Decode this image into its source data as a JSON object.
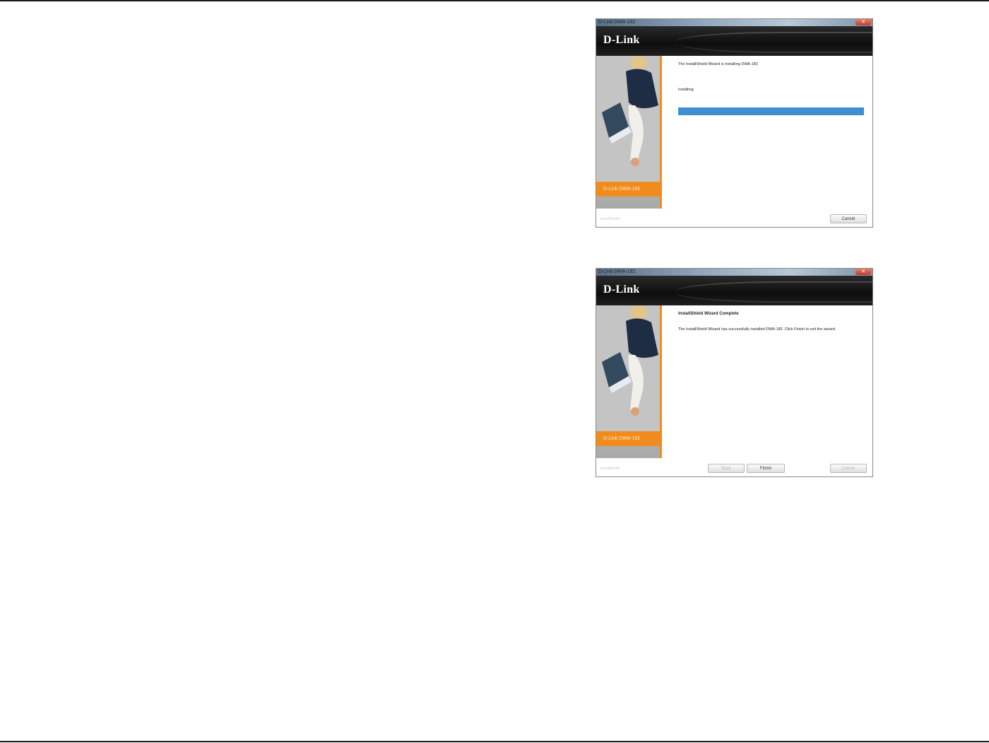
{
  "dialogs": [
    {
      "title": "D-Link DWA-182",
      "logo": "D-Link",
      "product_label": "D-Link DWA-182",
      "message": "The InstallShield Wizard is installing DWA-182",
      "status": "Installing",
      "progress_percent": 100,
      "footer_brand": "InstallShield",
      "cancel_label": "Cancel"
    },
    {
      "title": "D-Link DWA-182",
      "logo": "D-Link",
      "product_label": "D-Link DWA-182",
      "heading": "InstallShield Wizard Complete",
      "message": "The InstallShield Wizard has successfully installed DWA-182. Click Finish to exit the wizard.",
      "footer_brand": "InstallShield",
      "back_label": "Back",
      "finish_label": "Finish",
      "cancel_label": "Cancel"
    }
  ],
  "colors": {
    "accent": "#f08c1e",
    "progress": "#3f8fd0",
    "banner": "#111111"
  }
}
